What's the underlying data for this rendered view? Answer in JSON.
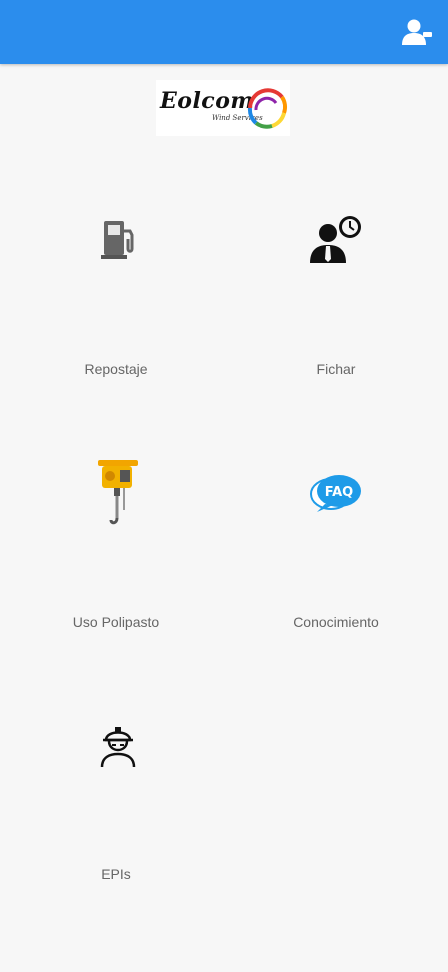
{
  "header": {
    "background": "#2b8ded",
    "profile_icon": "user-icon"
  },
  "logo": {
    "name": "Eolcom",
    "tagline": "Wind Services"
  },
  "menu": [
    {
      "label": "Repostaje",
      "icon": "fuel-pump-icon"
    },
    {
      "label": "Fichar",
      "icon": "clock-in-person-icon"
    },
    {
      "label": "Uso Polipasto",
      "icon": "hoist-icon"
    },
    {
      "label": "Conocimiento",
      "icon": "faq-icon"
    },
    {
      "label": "EPIs",
      "icon": "safety-worker-icon"
    }
  ]
}
